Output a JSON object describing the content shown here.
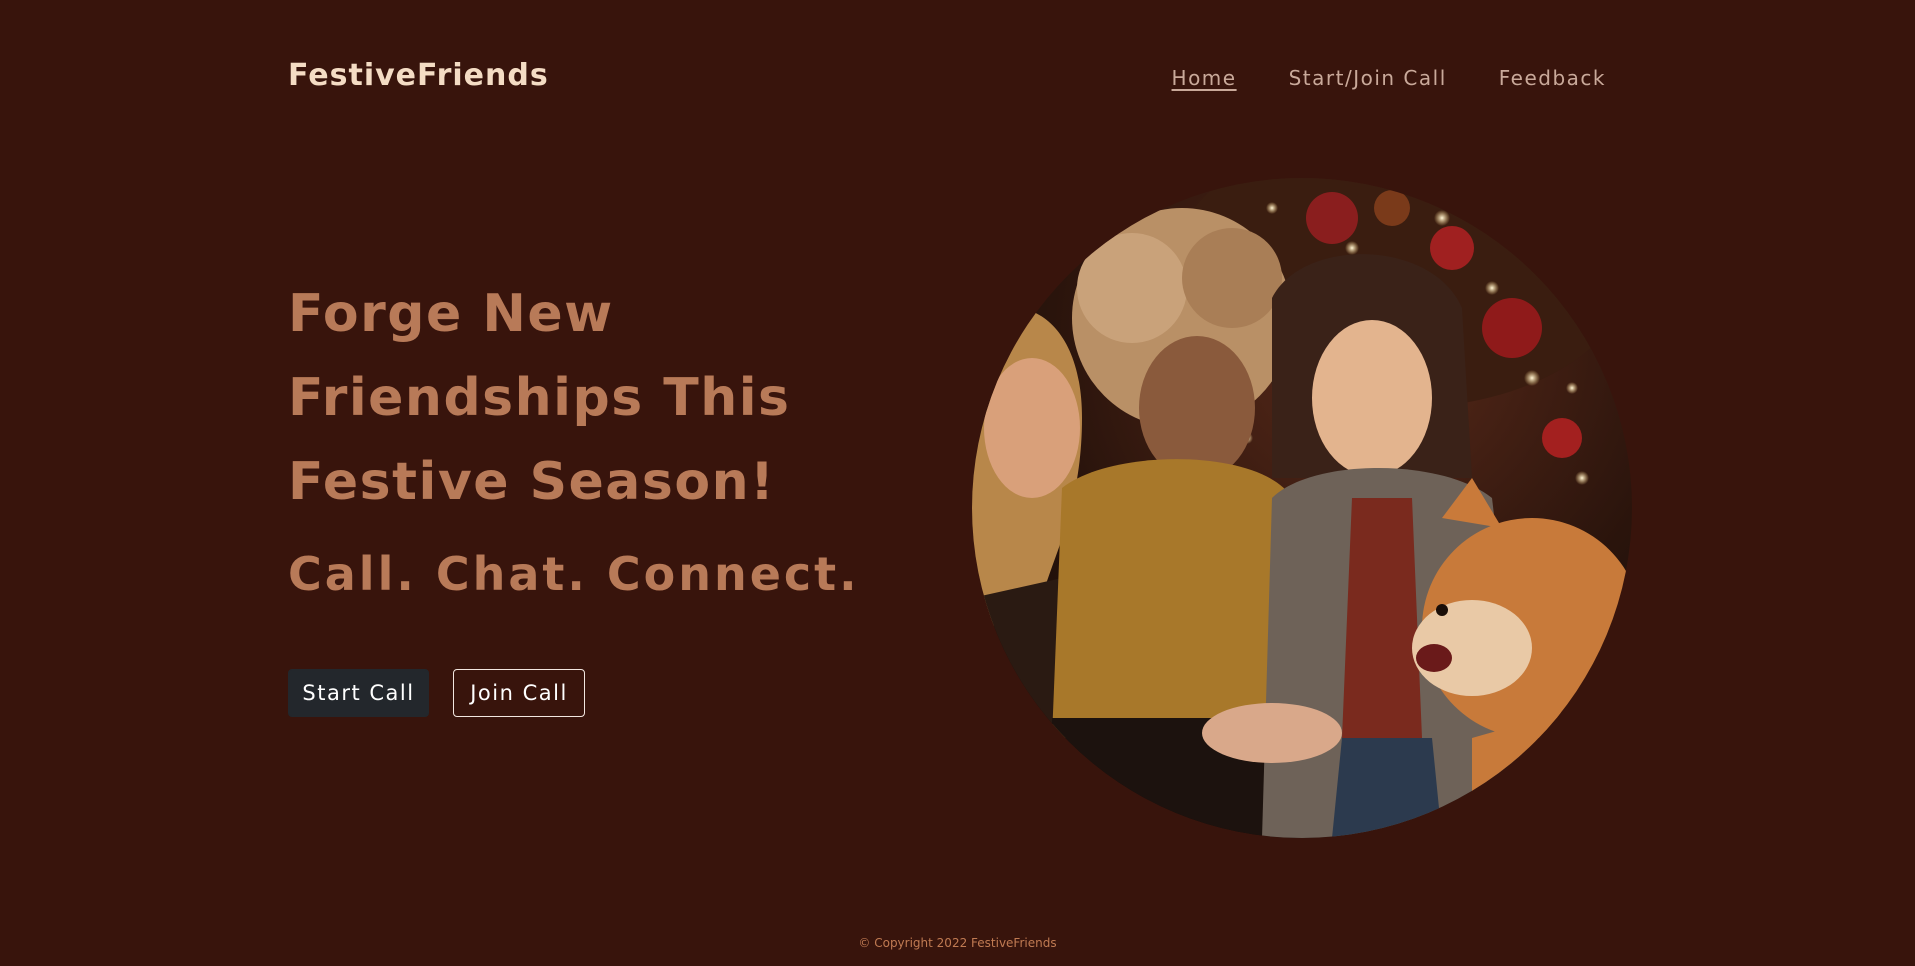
{
  "header": {
    "brand": "FestiveFriends",
    "nav": [
      {
        "label": "Home",
        "active": true
      },
      {
        "label": "Start/Join Call",
        "active": false
      },
      {
        "label": "Feedback",
        "active": false
      }
    ]
  },
  "hero": {
    "title_lines": [
      "Forge New",
      "Friendships This",
      "Festive Season!"
    ],
    "tagline": "Call. Chat. Connect.",
    "start_button": "Start Call",
    "join_button": "Join Call",
    "image_subject": "three friends laughing with a shiba inu dog in front of a lit christmas tree"
  },
  "footer": {
    "copyright": "© Copyright 2022 FestiveFriends"
  },
  "colors": {
    "background": "#38140c",
    "brand_text": "#f4dcc4",
    "heading": "#b87a58",
    "nav_text": "#c9a99a",
    "start_button_bg": "#23272c",
    "footer_text": "#c07a52"
  }
}
